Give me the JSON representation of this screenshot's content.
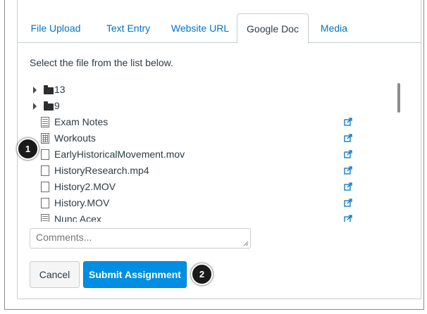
{
  "tabs": [
    {
      "label": "File Upload",
      "active": false
    },
    {
      "label": "Text Entry",
      "active": false
    },
    {
      "label": "Website URL",
      "active": false
    },
    {
      "label": "Google Doc",
      "active": true
    },
    {
      "label": "Media",
      "active": false
    }
  ],
  "panel": {
    "instruction": "Select the file from the list below."
  },
  "files": [
    {
      "name": "13",
      "kind": "folder",
      "icon": "folder-icon"
    },
    {
      "name": "9",
      "kind": "folder",
      "icon": "folder-icon"
    },
    {
      "name": "Exam Notes",
      "kind": "document",
      "icon": "document-icon"
    },
    {
      "name": "Workouts",
      "kind": "spreadsheet",
      "icon": "spreadsheet-icon"
    },
    {
      "name": "EarlyHistoricalMovement.mov",
      "kind": "file",
      "icon": "file-icon"
    },
    {
      "name": "HistoryResearch.mp4",
      "kind": "file",
      "icon": "file-icon"
    },
    {
      "name": "History2.MOV",
      "kind": "file",
      "icon": "file-icon"
    },
    {
      "name": "History.MOV",
      "kind": "file",
      "icon": "file-icon"
    },
    {
      "name": "Nunc Acex",
      "kind": "document",
      "icon": "document-icon"
    }
  ],
  "comments": {
    "placeholder": "Comments...",
    "value": ""
  },
  "buttons": {
    "cancel": "Cancel",
    "submit": "Submit Assignment"
  },
  "callouts": {
    "one": "1",
    "two": "2"
  },
  "colors": {
    "accent": "#008ee2",
    "link": "#0073c7",
    "text": "#2d3b45"
  }
}
